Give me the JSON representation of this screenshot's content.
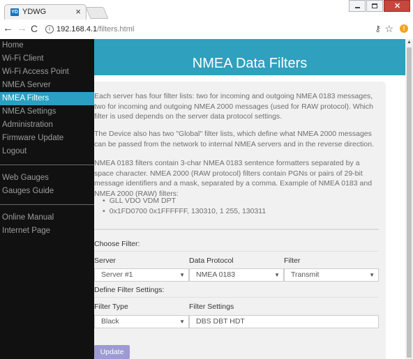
{
  "browser": {
    "tab_title": "YDWG",
    "tab_icon_text": "YD",
    "url_host": "192.168.4.1",
    "url_path": "/filters.html"
  },
  "sidebar": {
    "items": [
      {
        "label": "Home",
        "active": false
      },
      {
        "label": "Wi-Fi Client",
        "active": false
      },
      {
        "label": "Wi-Fi Access Point",
        "active": false
      },
      {
        "label": "NMEA Server",
        "active": false
      },
      {
        "label": "NMEA Filters",
        "active": true
      },
      {
        "label": "NMEA Settings",
        "active": false
      },
      {
        "label": "Administration",
        "active": false
      },
      {
        "label": "Firmware Update",
        "active": false
      },
      {
        "label": "Logout",
        "active": false
      }
    ],
    "group2": [
      {
        "label": "Web Gauges"
      },
      {
        "label": "Gauges Guide"
      }
    ],
    "group3": [
      {
        "label": "Online Manual"
      },
      {
        "label": "Internet Page"
      }
    ]
  },
  "page": {
    "title": "NMEA Data Filters",
    "para1": "Each server has four filter lists: two for incoming and outgoing NMEA 0183 messages, two for incoming and outgoing NMEA 2000 messages (used for RAW protocol). Which filter is used depends on the server data protocol settings.",
    "para2": "The Device also has two \"Global\" filter lists, which define what NMEA 2000 messages can be passed from the network to internal NMEA servers and in the reverse direction.",
    "para3": "NMEA 0183 filters contain 3-char NMEA 0183 sentence formatters separated by a space character. NMEA 2000 (RAW protocol) filters contain PGNs or pairs of 29-bit message identifiers and a mask, separated by a comma. Example of NMEA 0183 and NMEA 2000 (RAW) filters:",
    "examples": [
      "GLL VDO VDM DPT",
      "0x1FD0700 0x1FFFFFF, 130310, 1 255, 130311"
    ]
  },
  "form": {
    "choose_filter_label": "Choose Filter:",
    "server_label": "Server",
    "server_value": "Server #1",
    "protocol_label": "Data Protocol",
    "protocol_value": "NMEA 0183",
    "filter_label": "Filter",
    "filter_value": "Transmit",
    "define_label": "Define Filter Settings:",
    "filter_type_label": "Filter Type",
    "filter_type_value": "Black",
    "filter_settings_label": "Filter Settings",
    "filter_settings_value": "DBS DBT HDT",
    "update_button": "Update"
  },
  "colors": {
    "header_bg": "#2fa0bd",
    "sidebar_bg": "#111111",
    "active_item": "#2a9fc2",
    "button": "#9d9bd3"
  }
}
